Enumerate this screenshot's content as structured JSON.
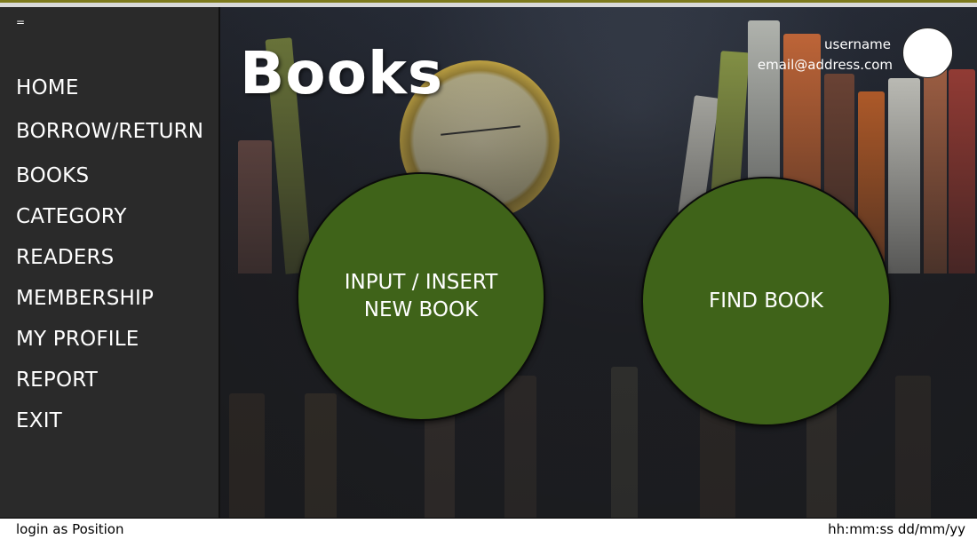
{
  "sidebar": {
    "toggle_label": "=",
    "items": [
      {
        "label": "HOME"
      },
      {
        "label": "BORROW/RETURN"
      },
      {
        "label": "BOOKS"
      },
      {
        "label": "CATEGORY"
      },
      {
        "label": "READERS"
      },
      {
        "label": "MEMBERSHIP"
      },
      {
        "label": "MY PROFILE"
      },
      {
        "label": "REPORT"
      },
      {
        "label": "EXIT"
      }
    ]
  },
  "header": {
    "title": "Books",
    "username": "username",
    "email": "email@address.com"
  },
  "actions": {
    "insert_line1": "INPUT / INSERT",
    "insert_line2": "NEW BOOK",
    "find_label": "FIND BOOK"
  },
  "status": {
    "login": "login as Position",
    "datetime": "hh:mm:ss dd/mm/yy"
  },
  "colors": {
    "sidebar_bg": "#2a2a2a",
    "button_green": "#3f6319",
    "accent_olive": "#7d7a1d"
  }
}
